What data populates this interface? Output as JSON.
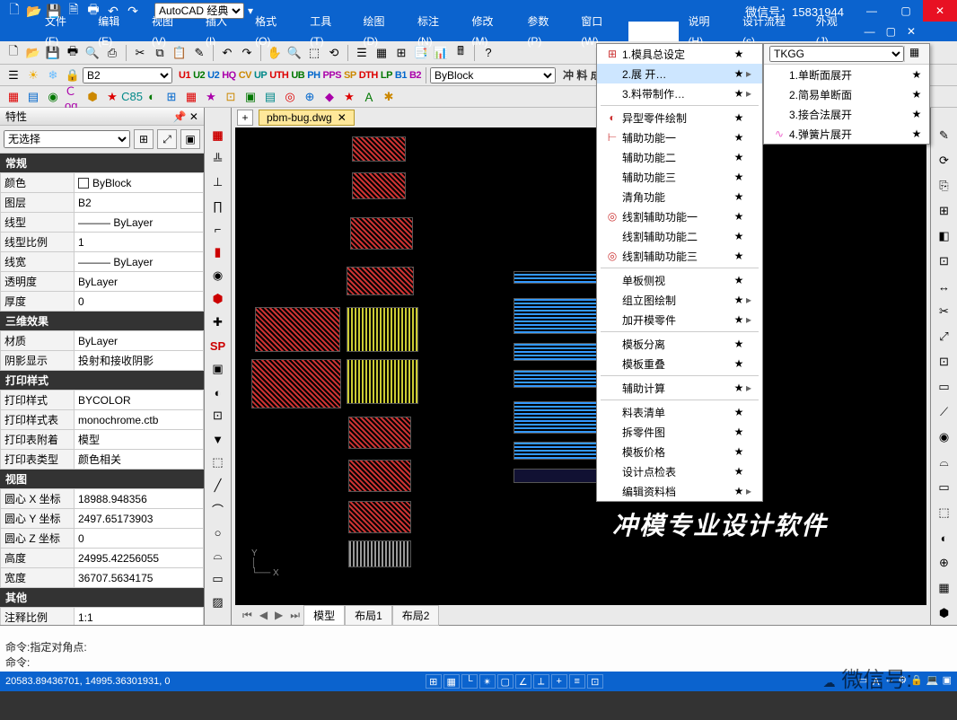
{
  "title": {
    "workspace": "AutoCAD 经典",
    "wechat": "微信号：15831944"
  },
  "menus": [
    "文件(F)",
    "编辑(E)",
    "视图(V)",
    "插入(I)",
    "格式(O)",
    "工具(T)",
    "绘图(D)",
    "标注(N)",
    "修改(M)",
    "参数(P)",
    "窗口(W)"
  ],
  "menu_right": [
    "说明(H)",
    "设计流程(s)",
    "外观(J)"
  ],
  "layer_combo": "B2",
  "linetype_combo": "ByBlock",
  "prop": {
    "title": "特性",
    "select": "无选择",
    "groups": {
      "general": {
        "title": "常规",
        "rows": [
          [
            "颜色",
            "ByBlock"
          ],
          [
            "图层",
            "B2"
          ],
          [
            "线型",
            "——— ByLayer"
          ],
          [
            "线型比例",
            "1"
          ],
          [
            "线宽",
            "——— ByLayer"
          ],
          [
            "透明度",
            "ByLayer"
          ],
          [
            "厚度",
            "0"
          ]
        ]
      },
      "three_d": {
        "title": "三维效果",
        "rows": [
          [
            "材质",
            "ByLayer"
          ],
          [
            "阴影显示",
            "投射和接收阴影"
          ]
        ]
      },
      "print": {
        "title": "打印样式",
        "rows": [
          [
            "打印样式",
            "BYCOLOR"
          ],
          [
            "打印样式表",
            "monochrome.ctb"
          ],
          [
            "打印表附着",
            "模型"
          ],
          [
            "打印表类型",
            "颜色相关"
          ]
        ]
      },
      "view": {
        "title": "视图",
        "rows": [
          [
            "圆心 X 坐标",
            "18988.948356"
          ],
          [
            "圆心 Y 坐标",
            "2497.65173903"
          ],
          [
            "圆心 Z 坐标",
            "0"
          ],
          [
            "高度",
            "24995.42256055"
          ],
          [
            "宽度",
            "36707.5634175"
          ]
        ]
      },
      "other": {
        "title": "其他",
        "rows": [
          [
            "注释比例",
            "1:1"
          ]
        ]
      }
    }
  },
  "doc_tab": "pbm-bug.dwg",
  "watermark": "冲模专业设计软件",
  "layout_tabs": [
    "模型",
    "布局1",
    "布局2"
  ],
  "cmd": {
    "l1": "命令:指定对角点:",
    "l2": "命令:"
  },
  "cmd_watermark": "微信号:",
  "status_coords": "20583.89436701, 14995.36301931, 0",
  "ctx_menu": [
    {
      "ic": "⊞",
      "lbl": "1.模具总设定",
      "star": "★",
      "arr": ""
    },
    {
      "ic": "",
      "lbl": "2.展  开…",
      "star": "★",
      "arr": "▸",
      "hover": true
    },
    {
      "ic": "",
      "lbl": "3.料带制作…",
      "star": "★",
      "arr": "▸"
    },
    {
      "hr": true
    },
    {
      "ic": "◐",
      "lbl": "异型零件绘制",
      "star": "★",
      "arr": ""
    },
    {
      "ic": "⊢",
      "lbl": "辅助功能一",
      "star": "★",
      "arr": ""
    },
    {
      "ic": "",
      "lbl": "辅助功能二",
      "star": "★",
      "arr": ""
    },
    {
      "ic": "",
      "lbl": "辅助功能三",
      "star": "★",
      "arr": ""
    },
    {
      "ic": "",
      "lbl": "清角功能",
      "star": "★",
      "arr": ""
    },
    {
      "ic": "◎",
      "lbl": "线割辅助功能一",
      "star": "★",
      "arr": ""
    },
    {
      "ic": "",
      "lbl": "线割辅助功能二",
      "star": "★",
      "arr": ""
    },
    {
      "ic": "◎",
      "lbl": "线割辅助功能三",
      "star": "★",
      "arr": ""
    },
    {
      "hr": true
    },
    {
      "ic": "",
      "lbl": "单板侧视",
      "star": "★",
      "arr": ""
    },
    {
      "ic": "",
      "lbl": "组立图绘制",
      "star": "★",
      "arr": "▸"
    },
    {
      "ic": "",
      "lbl": "加开模零件",
      "star": "★",
      "arr": "▸"
    },
    {
      "hr": true
    },
    {
      "ic": "",
      "lbl": "模板分离",
      "star": "★",
      "arr": ""
    },
    {
      "ic": "",
      "lbl": "模板重叠",
      "star": "★",
      "arr": ""
    },
    {
      "hr": true
    },
    {
      "ic": "",
      "lbl": "辅助计算",
      "star": "★",
      "arr": "▸"
    },
    {
      "hr": true
    },
    {
      "ic": "",
      "lbl": "料表清单",
      "star": "★",
      "arr": ""
    },
    {
      "ic": "",
      "lbl": "拆零件图",
      "star": "★",
      "arr": ""
    },
    {
      "ic": "",
      "lbl": "模板价格",
      "star": "★",
      "arr": ""
    },
    {
      "ic": "",
      "lbl": "设计点检表",
      "star": "★",
      "arr": ""
    },
    {
      "ic": "",
      "lbl": "编辑资料档",
      "star": "★",
      "arr": "▸"
    }
  ],
  "submenu": {
    "tkgg": "TKGG",
    "items": [
      {
        "ic": "",
        "lbl": "1.单断面展开",
        "star": "★"
      },
      {
        "ic": "",
        "lbl": "2.简易单断面",
        "star": "★"
      },
      {
        "ic": "",
        "lbl": "3.接合法展开",
        "star": "★"
      },
      {
        "ic": "∿",
        "lbl": "4.弹簧片展开",
        "star": "★"
      }
    ]
  }
}
